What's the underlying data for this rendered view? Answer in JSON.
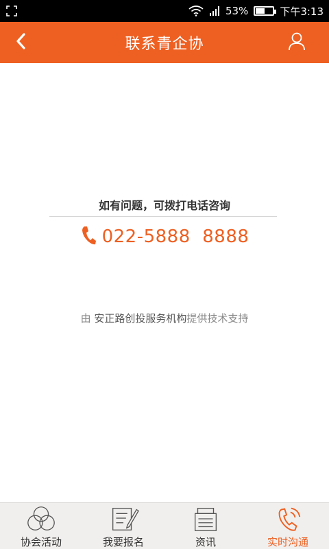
{
  "status_bar": {
    "battery_percent": "53%",
    "battery_level": 0.53,
    "time": "下午3:13"
  },
  "header": {
    "title": "联系青企协"
  },
  "contact": {
    "hint": "如有问题，可拨打电话咨询",
    "phone": "022-5888  8888"
  },
  "support": {
    "prefix": "由 ",
    "org": "安正路创投服务机构",
    "suffix": "提供技术支持"
  },
  "bottom_nav": {
    "items": [
      {
        "label": "协会活动",
        "icon": "circles-icon"
      },
      {
        "label": "我要报名",
        "icon": "signup-form-icon"
      },
      {
        "label": "资讯",
        "icon": "news-icon"
      },
      {
        "label": "实时沟通",
        "icon": "phone-call-icon",
        "active": true
      }
    ]
  },
  "colors": {
    "accent": "#ee6022",
    "nav_bg": "#f1efed"
  }
}
